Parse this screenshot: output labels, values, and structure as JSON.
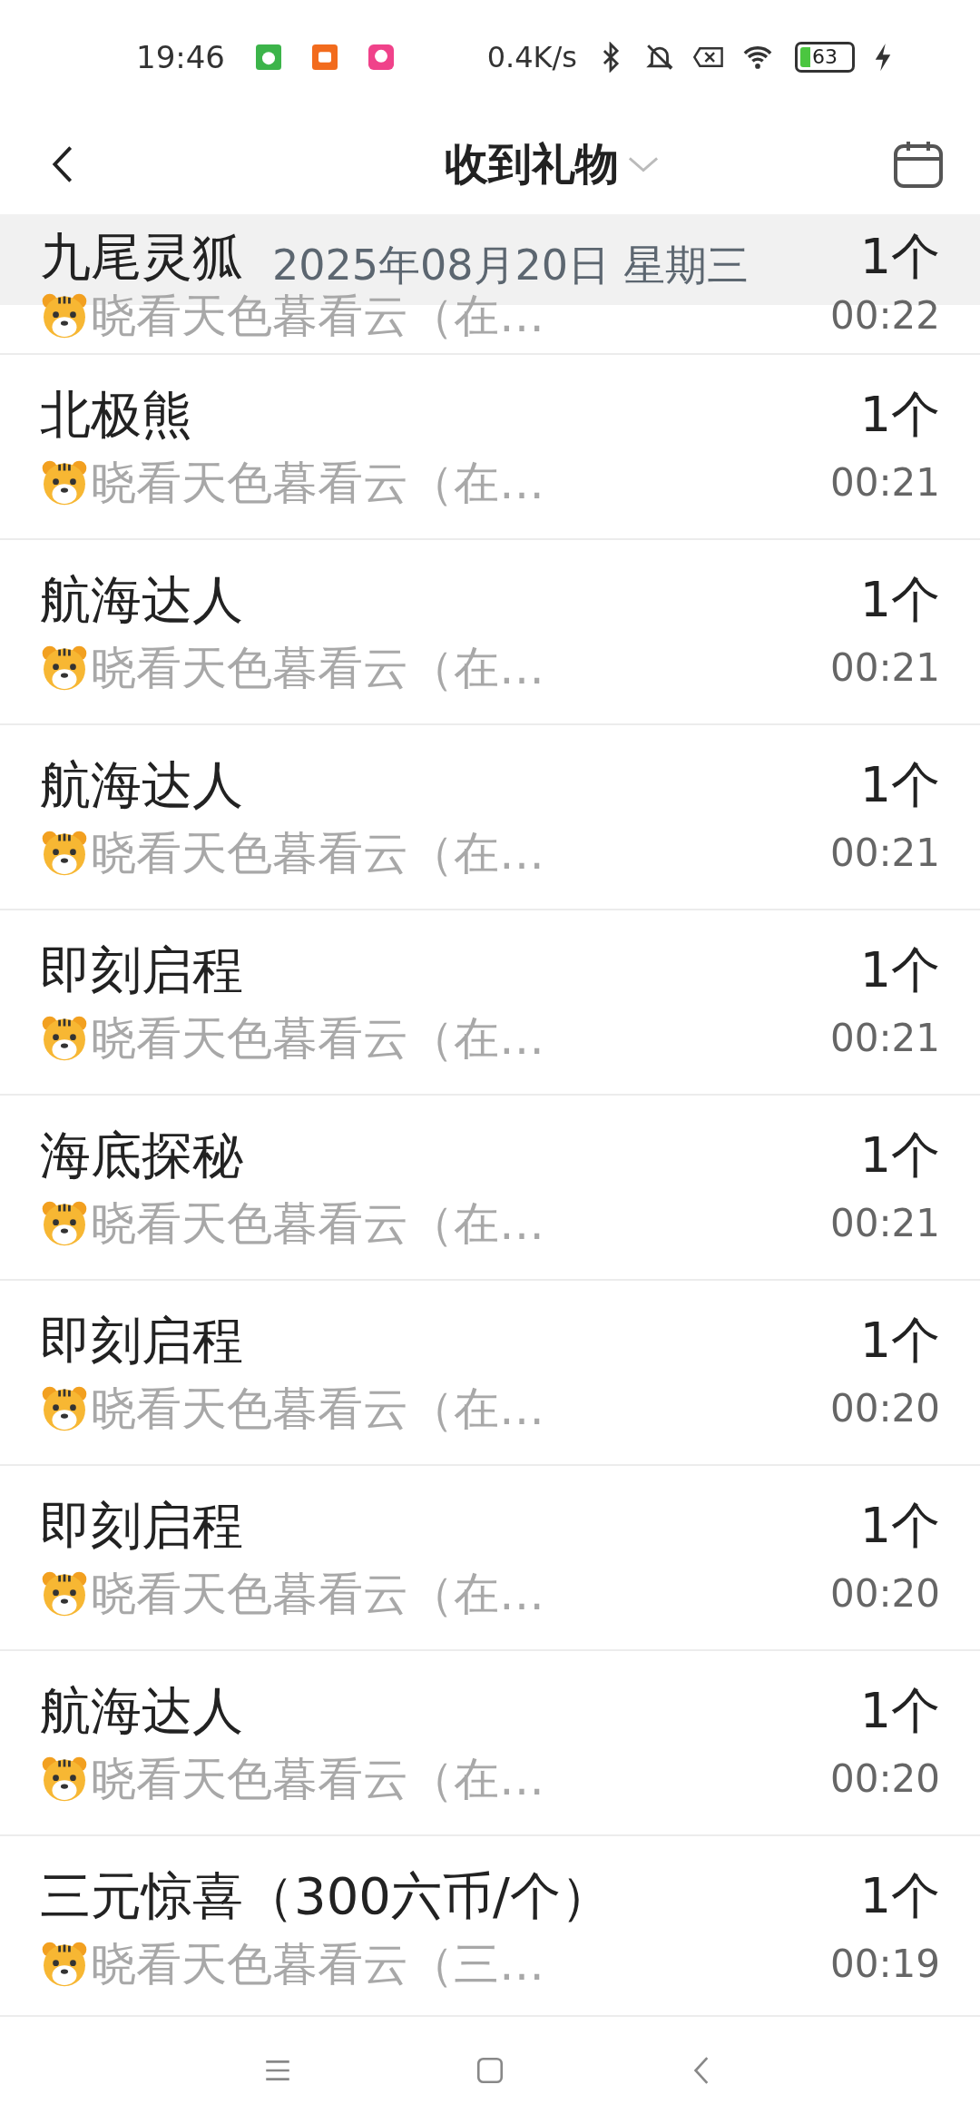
{
  "status_bar": {
    "time": "19:46",
    "speed": "0.4K/s",
    "battery": "63"
  },
  "header": {
    "title": "收到礼物"
  },
  "date_header": "2025年08月20日 星期三",
  "gifts": [
    {
      "name": "九尾灵狐",
      "count": "1个",
      "sender": "晓看天色暮看云（在…",
      "time": "00:22"
    },
    {
      "name": "北极熊",
      "count": "1个",
      "sender": "晓看天色暮看云（在…",
      "time": "00:21"
    },
    {
      "name": "航海达人",
      "count": "1个",
      "sender": "晓看天色暮看云（在…",
      "time": "00:21"
    },
    {
      "name": "航海达人",
      "count": "1个",
      "sender": "晓看天色暮看云（在…",
      "time": "00:21"
    },
    {
      "name": "即刻启程",
      "count": "1个",
      "sender": "晓看天色暮看云（在…",
      "time": "00:21"
    },
    {
      "name": "海底探秘",
      "count": "1个",
      "sender": "晓看天色暮看云（在…",
      "time": "00:21"
    },
    {
      "name": "即刻启程",
      "count": "1个",
      "sender": "晓看天色暮看云（在…",
      "time": "00:20"
    },
    {
      "name": "即刻启程",
      "count": "1个",
      "sender": "晓看天色暮看云（在…",
      "time": "00:20"
    },
    {
      "name": "航海达人",
      "count": "1个",
      "sender": "晓看天色暮看云（在…",
      "time": "00:20"
    },
    {
      "name": "三元惊喜（300六币/个）",
      "count": "1个",
      "sender": "晓看天色暮看云（三…",
      "time": "00:19"
    }
  ]
}
